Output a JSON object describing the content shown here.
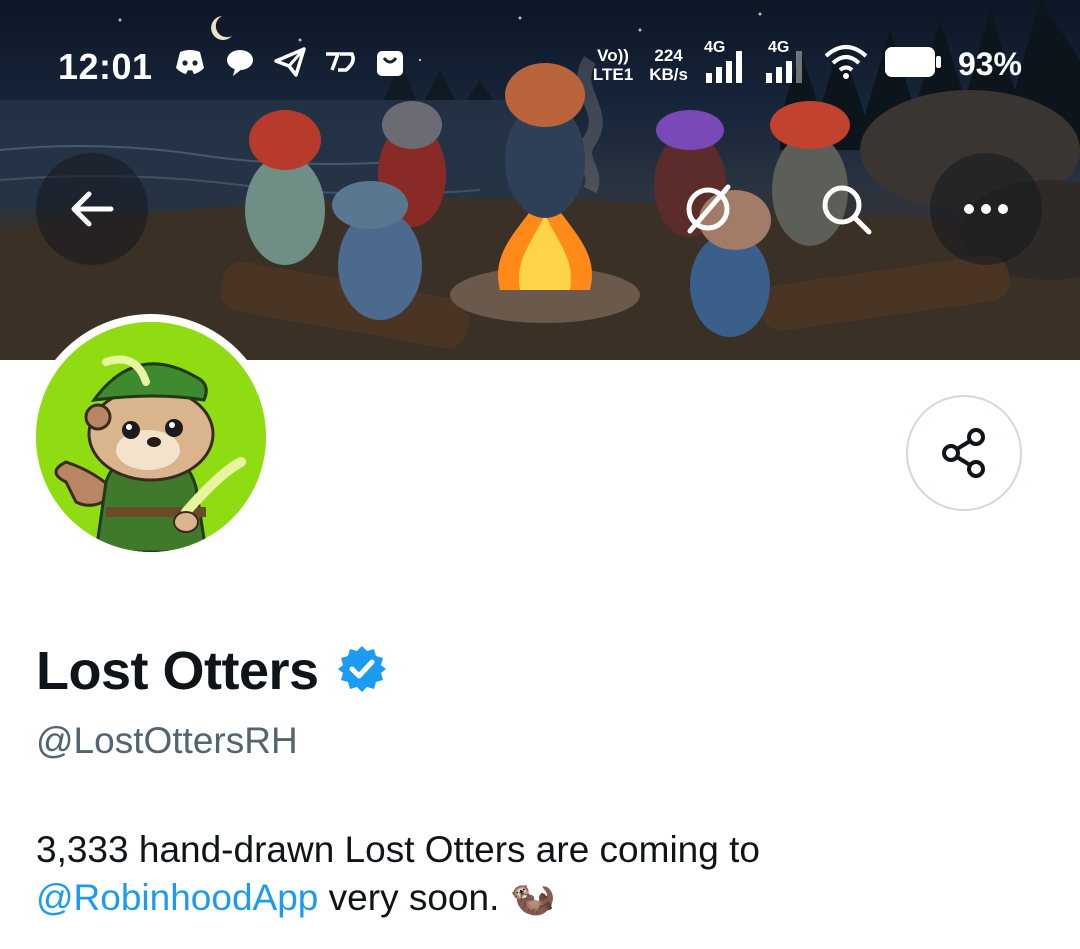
{
  "status_bar": {
    "time": "12:01",
    "volte_top": "Vo))",
    "volte_bottom": "LTE1",
    "net_speed_value": "224",
    "net_speed_unit": "KB/s",
    "signal1_label": "4G",
    "signal2_label": "4G",
    "battery_percent": "93%",
    "battery_level": 0.93
  },
  "header": {
    "back_icon": "arrow-left-icon",
    "grok_icon": "slash-circle-icon",
    "search_icon": "search-icon",
    "more_icon": "more-horizontal-icon"
  },
  "profile": {
    "display_name": "Lost Otters",
    "verified": true,
    "handle": "@LostOttersRH",
    "bio_text": "3,333 hand-drawn Lost Otters are coming to",
    "bio_mention": "@RobinhoodApp",
    "bio_tail": " very soon. 🦦",
    "share_icon": "share-icon"
  },
  "colors": {
    "accent": "#1d9bf0",
    "secondary_text": "#536471",
    "avatar_bg": "#8fdc12"
  }
}
